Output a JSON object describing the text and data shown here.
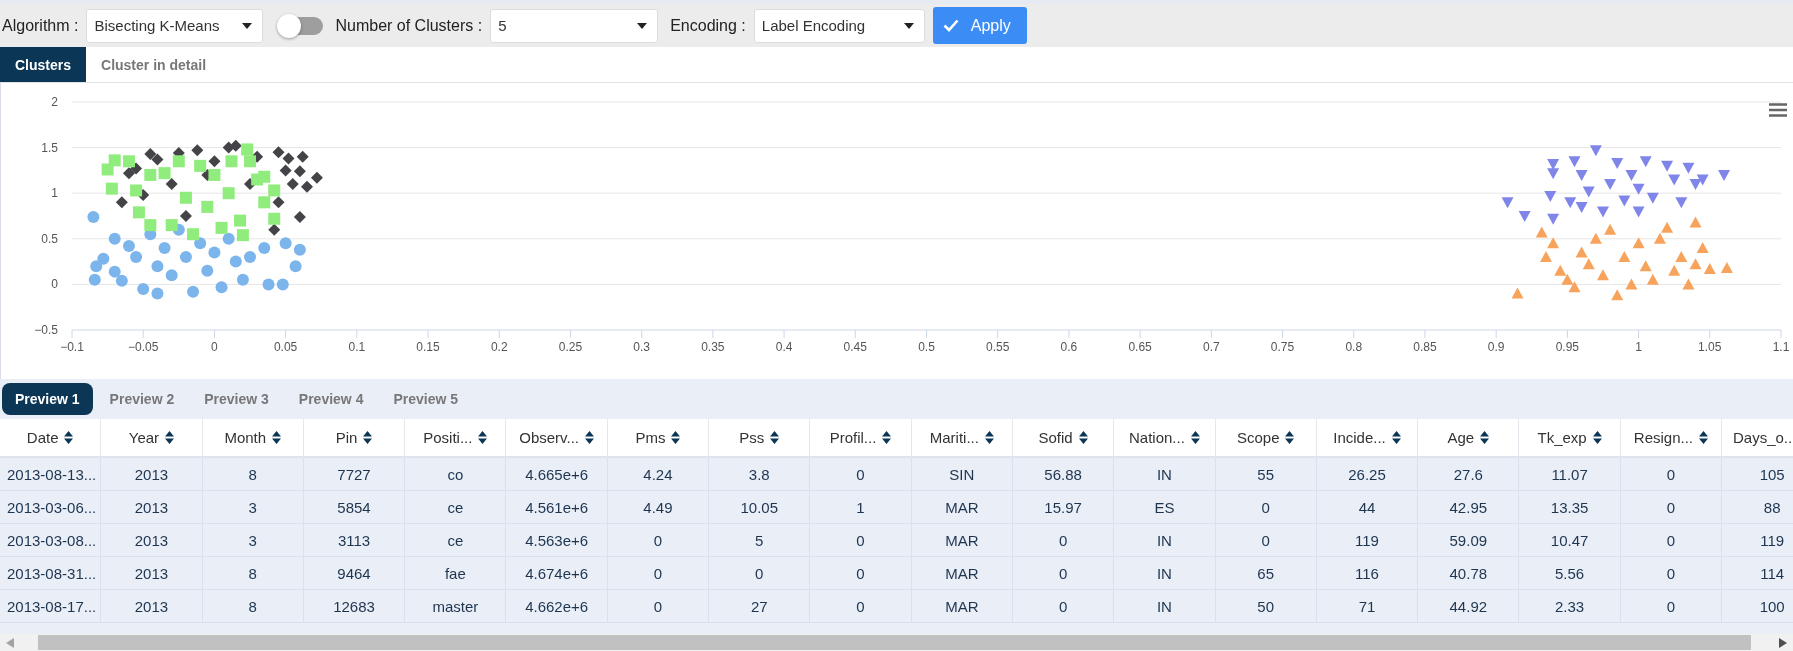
{
  "toolbar": {
    "algorithm": {
      "label": "Algorithm :",
      "value": "Bisecting K-Means"
    },
    "toggle": {
      "on": false
    },
    "clusters": {
      "label": "Number of Clusters :",
      "value": "5"
    },
    "encoding": {
      "label": "Encoding :",
      "value": "Label Encoding"
    },
    "apply": "Apply"
  },
  "view_tabs": [
    {
      "label": "Clusters",
      "selected": true
    },
    {
      "label": "Cluster in detail",
      "selected": false
    }
  ],
  "chart": {
    "chart_data": {
      "type": "scatter",
      "xlim": [
        -0.1,
        1.1
      ],
      "ylim": [
        -0.5,
        2
      ],
      "grid": true,
      "xticks": [
        {
          "value": -0.1,
          "label": "−0.1"
        },
        {
          "value": -0.05,
          "label": "−0.05"
        },
        0,
        0.05,
        0.1,
        0.15,
        0.2,
        0.25,
        0.3,
        0.35,
        0.4,
        0.45,
        0.5,
        0.55,
        0.6,
        0.65,
        0.7,
        0.75,
        0.8,
        0.85,
        0.9,
        0.95,
        1,
        1.05,
        1.1
      ],
      "yticks": [
        {
          "value": -0.5,
          "label": "−0.5"
        },
        0,
        0.5,
        1,
        1.5,
        2
      ],
      "series": [
        {
          "color": "#7cb5ec",
          "marker": "circle",
          "x": [
            -0.085,
            -0.084,
            -0.083,
            -0.078,
            -0.07,
            -0.07,
            -0.065,
            -0.06,
            -0.055,
            -0.05,
            -0.045,
            -0.04,
            -0.04,
            -0.035,
            -0.03,
            -0.025,
            -0.02,
            -0.015,
            -0.01,
            -0.005,
            0,
            0.005,
            0.01,
            0.015,
            0.02,
            0.025,
            0.035,
            0.038,
            0.05,
            0.06,
            0.057,
            0.048
          ],
          "values": [
            0.74,
            0.05,
            0.2,
            0.28,
            0.5,
            0.14,
            0.04,
            0.42,
            0.3,
            -0.05,
            0.55,
            0.2,
            -0.1,
            0.4,
            0.1,
            0.6,
            0.3,
            -0.08,
            0.45,
            0.15,
            0.35,
            -0.03,
            0.5,
            0.25,
            0.05,
            0.3,
            0.4,
            0,
            0.45,
            0.38,
            0.2,
            0
          ]
        },
        {
          "color": "#434348",
          "marker": "diamond",
          "x": [
            -0.065,
            -0.06,
            -0.055,
            -0.045,
            -0.04,
            -0.03,
            -0.025,
            -0.02,
            -0.012,
            -0.005,
            0,
            0.01,
            0.015,
            0.045,
            0.025,
            0.03,
            0.055,
            0.042,
            0.045,
            0.05,
            0.052,
            0.06,
            0.062,
            0.065,
            0.072,
            0.06,
            -0.05
          ],
          "values": [
            0.9,
            1.22,
            1.27,
            1.43,
            1.37,
            1.1,
            1.44,
            0.75,
            1.47,
            1.2,
            1.35,
            1.5,
            1.52,
            1.45,
            1.1,
            1.4,
            1.1,
            0.6,
            0.9,
            1.25,
            1.38,
            1.24,
            1.4,
            1.07,
            1.17,
            0.74,
            0.98
          ]
        },
        {
          "color": "#90ed7d",
          "marker": "square",
          "x": [
            -0.075,
            -0.07,
            -0.072,
            -0.06,
            -0.055,
            -0.053,
            -0.045,
            -0.045,
            -0.035,
            -0.03,
            -0.025,
            -0.02,
            -0.015,
            -0.01,
            -0.005,
            0,
            0.005,
            0.01,
            0.012,
            0.018,
            0.02,
            0.023,
            0.025,
            0.03,
            0.035,
            0.035,
            0.042,
            0.042
          ],
          "values": [
            1.26,
            1.36,
            1.05,
            1.35,
            1.03,
            0.79,
            1.2,
            0.65,
            1.22,
            0.65,
            1.35,
            0.95,
            0.55,
            1.3,
            0.85,
            1.2,
            0.62,
            1,
            1.35,
            0.7,
            0.54,
            1.48,
            1.35,
            1.15,
            1.18,
            0.9,
            1.03,
            0.72
          ]
        },
        {
          "color": "#8085e9",
          "marker": "triangle-down",
          "x": [
            0.908,
            0.92,
            0.938,
            0.94,
            0.94,
            0.94,
            0.952,
            0.955,
            0.96,
            0.965,
            0.97,
            0.975,
            0.98,
            0.985,
            0.99,
            0.995,
            1,
            1.005,
            1.01,
            1.02,
            1.025,
            1.03,
            1.035,
            1.04,
            1.045,
            1.06,
            0.96,
            1
          ],
          "values": [
            0.9,
            0.75,
            0.97,
            1.32,
            1.22,
            0.72,
            0.9,
            1.35,
            1.2,
            1.02,
            1.47,
            0.8,
            1.1,
            1.33,
            0.92,
            1.2,
            1.05,
            1.35,
            0.95,
            1.3,
            1.15,
            0.9,
            1.28,
            1.1,
            1.15,
            1.2,
            0.85,
            0.8
          ]
        },
        {
          "color": "#f7a35c",
          "marker": "triangle",
          "x": [
            0.915,
            0.932,
            0.935,
            0.94,
            0.945,
            0.95,
            0.955,
            0.96,
            0.965,
            0.97,
            0.975,
            0.98,
            0.985,
            0.99,
            0.995,
            1,
            1.005,
            1.01,
            1.015,
            1.02,
            1.025,
            1.03,
            1.035,
            1.04,
            1.045,
            1.05,
            1.062,
            1.04
          ],
          "values": [
            -0.1,
            0.57,
            0.3,
            0.45,
            0.15,
            0.05,
            -0.03,
            0.35,
            0.22,
            0.5,
            0.1,
            0.6,
            -0.12,
            0.3,
            0,
            0.45,
            0.2,
            0.05,
            0.5,
            0.62,
            0.15,
            0.3,
            0,
            0.68,
            0.4,
            0.17,
            0.18,
            0.22
          ]
        }
      ]
    }
  },
  "preview_tabs": [
    {
      "label": "Preview 1",
      "selected": true
    },
    {
      "label": "Preview 2",
      "selected": false
    },
    {
      "label": "Preview 3",
      "selected": false
    },
    {
      "label": "Preview 4",
      "selected": false
    },
    {
      "label": "Preview 5",
      "selected": false
    }
  ],
  "table": {
    "columns": [
      "Date",
      "Year",
      "Month",
      "Pin",
      "Positi...",
      "Observ...",
      "Pms",
      "Pss",
      "Profil...",
      "Mariti...",
      "Sofid",
      "Nation...",
      "Scope",
      "Incide...",
      "Age",
      "Tk_exp",
      "Resign...",
      "Days_o..."
    ],
    "rows": [
      [
        "2013-08-13...",
        "2013",
        "8",
        "7727",
        "co",
        "4.665e+6",
        "4.24",
        "3.8",
        "0",
        "SIN",
        "56.88",
        "IN",
        "55",
        "26.25",
        "27.6",
        "11.07",
        "0",
        "105"
      ],
      [
        "2013-03-06...",
        "2013",
        "3",
        "5854",
        "ce",
        "4.561e+6",
        "4.49",
        "10.05",
        "1",
        "MAR",
        "15.97",
        "ES",
        "0",
        "44",
        "42.95",
        "13.35",
        "0",
        "88"
      ],
      [
        "2013-03-08...",
        "2013",
        "3",
        "3113",
        "ce",
        "4.563e+6",
        "0",
        "5",
        "0",
        "MAR",
        "0",
        "IN",
        "0",
        "119",
        "59.09",
        "10.47",
        "0",
        "119"
      ],
      [
        "2013-08-31...",
        "2013",
        "8",
        "9464",
        "fae",
        "4.674e+6",
        "0",
        "0",
        "0",
        "MAR",
        "0",
        "IN",
        "65",
        "116",
        "40.78",
        "5.56",
        "0",
        "114"
      ],
      [
        "2013-08-17...",
        "2013",
        "8",
        "12683",
        "master",
        "4.662e+6",
        "0",
        "27",
        "0",
        "MAR",
        "0",
        "IN",
        "50",
        "71",
        "44.92",
        "2.33",
        "0",
        "100"
      ]
    ]
  }
}
